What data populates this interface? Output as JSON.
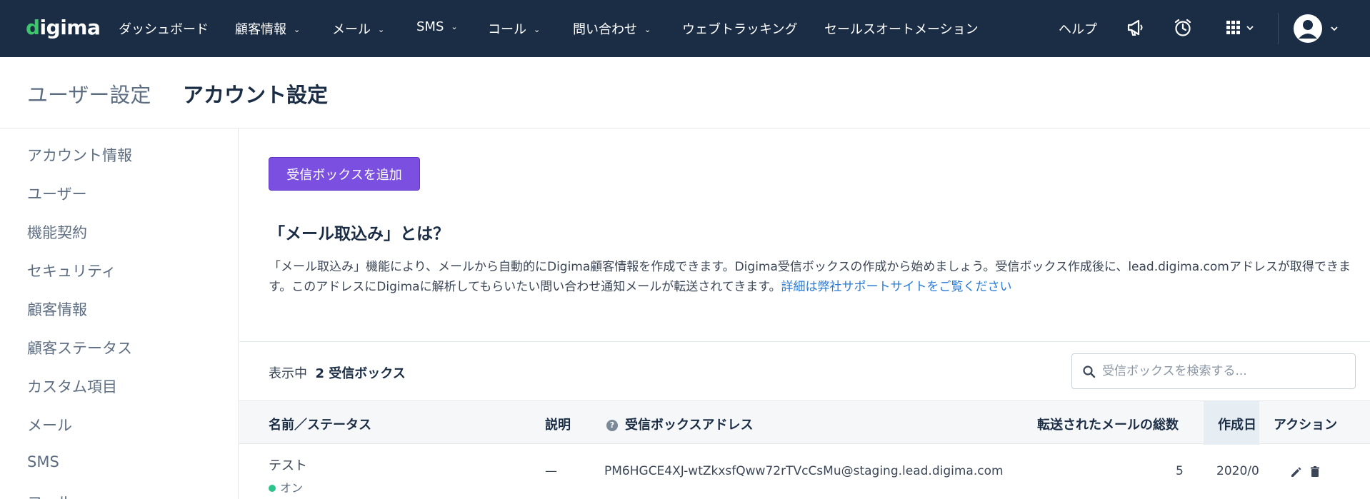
{
  "brand": {
    "logo_prefix": "d",
    "logo_rest": "igima"
  },
  "topnav": {
    "items": [
      {
        "label": "ダッシュボード",
        "has_dropdown": false
      },
      {
        "label": "顧客情報",
        "has_dropdown": true
      },
      {
        "label": "メール",
        "has_dropdown": true
      },
      {
        "label": "SMS",
        "has_dropdown": true
      },
      {
        "label": "コール",
        "has_dropdown": true
      },
      {
        "label": "問い合わせ",
        "has_dropdown": true
      },
      {
        "label": "ウェブトラッキング",
        "has_dropdown": false
      },
      {
        "label": "セールスオートメーション",
        "has_dropdown": false
      }
    ],
    "help_label": "ヘルプ",
    "chevron": "⌄",
    "icons": [
      "megaphone-icon",
      "alarm-clock-icon",
      "apps-grid-icon",
      "avatar-icon"
    ]
  },
  "page_header": {
    "tabs": [
      {
        "label": "ユーザー設定",
        "active": false
      },
      {
        "label": "アカウント設定",
        "active": true
      }
    ]
  },
  "sidebar": {
    "items": [
      {
        "label": "アカウント情報"
      },
      {
        "label": "ユーザー"
      },
      {
        "label": "機能契約"
      },
      {
        "label": "セキュリティ"
      },
      {
        "label": "顧客情報"
      },
      {
        "label": "顧客ステータス"
      },
      {
        "label": "カスタム項目"
      },
      {
        "label": "メール"
      },
      {
        "label": "SMS"
      },
      {
        "label": "コール"
      }
    ]
  },
  "main": {
    "add_button_label": "受信ボックスを追加",
    "info_title": "「メール取込み」とは？",
    "info_body": "「メール取込み」機能により、メールから自動的にDigima顧客情報を作成できます。Digima受信ボックスの作成から始めましょう。受信ボックス作成後に、lead.digima.comアドレスが取得できます。このアドレスにDigimaに解析してもらいたい問い合わせ通知メールが転送されてきます。",
    "info_link": "詳細は弊社サポートサイトをご覧ください",
    "count_prefix": "表示中",
    "count_value": "2 受信ボックス",
    "search_placeholder": "受信ボックスを検索する...",
    "table": {
      "headers": {
        "name_status": "名前／ステータス",
        "description": "説明",
        "address": "受信ボックスアドレス",
        "forwarded_total": "転送されたメールの総数",
        "created": "作成日",
        "actions": "アクション"
      },
      "help_glyph": "?",
      "rows": [
        {
          "name": "テスト",
          "status": "オン",
          "description": "—",
          "address": "PM6HGCE4XJ-wtZkxsfQww72rTVcCsMu@staging.lead.digima.com",
          "forwarded_total": "5",
          "created": "2020/0"
        }
      ]
    }
  },
  "colors": {
    "nav_bg": "#1b2d45",
    "accent_button": "#7b4fe0",
    "link": "#2a7bd5",
    "status_on": "#2bc48a",
    "logo_dot": "#3cc76b"
  }
}
